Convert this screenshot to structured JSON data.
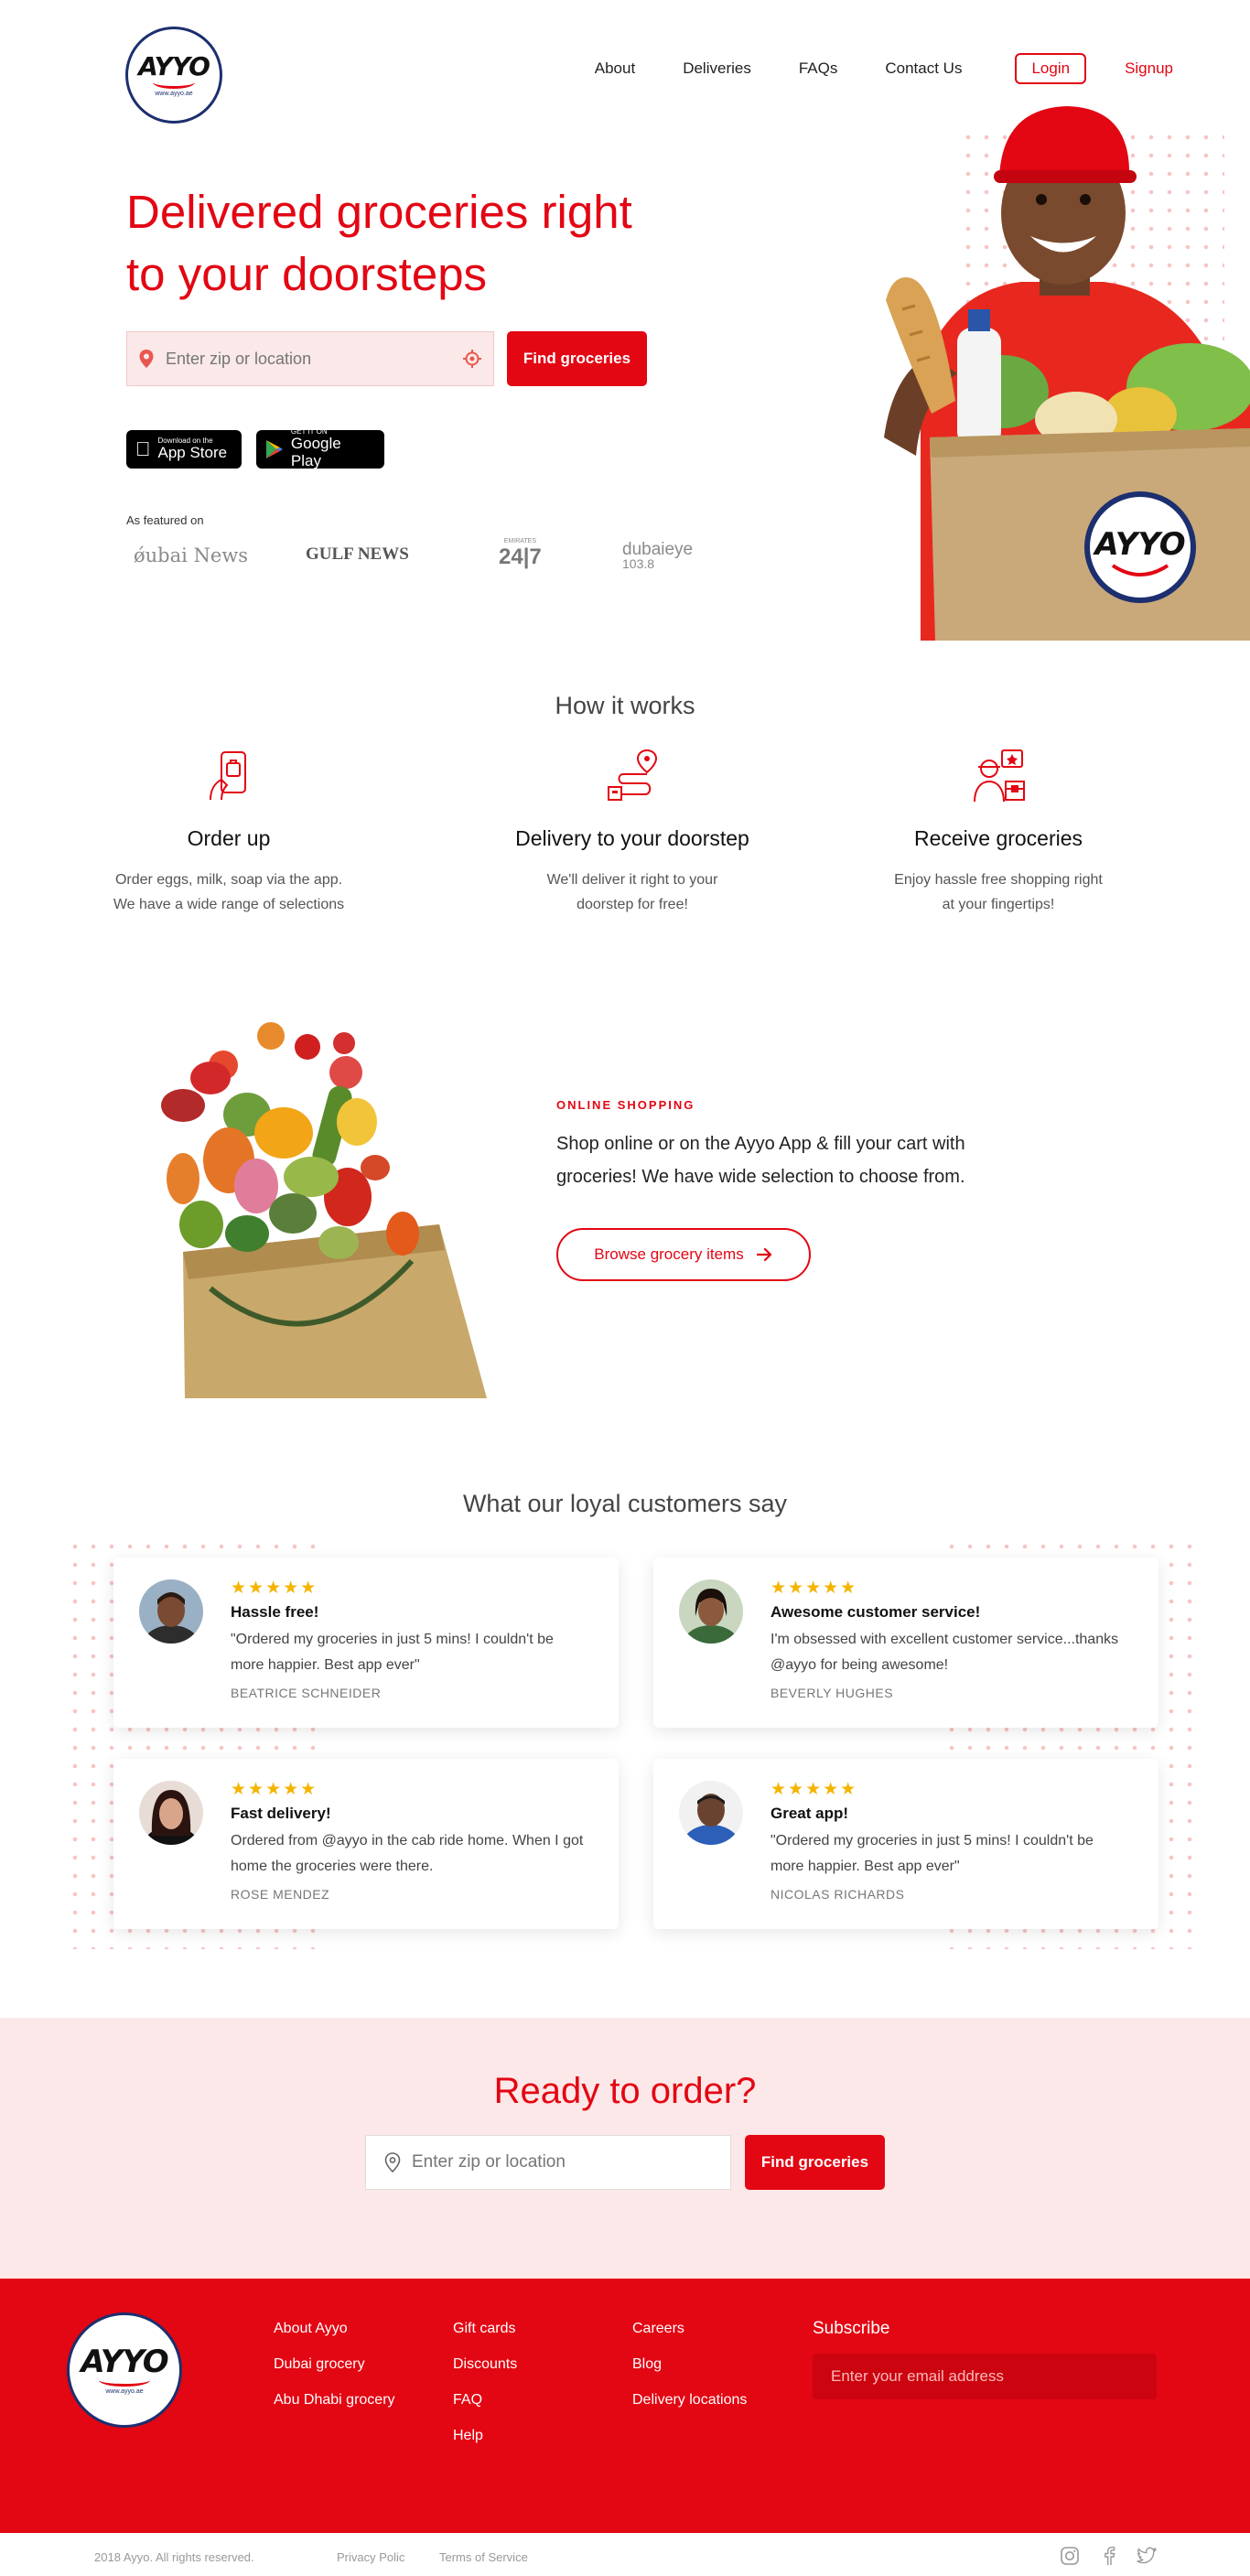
{
  "nav": {
    "logo_text": "AYYO",
    "logo_url": "www.ayyo.ae",
    "links": [
      "About",
      "Deliveries",
      "FAQs",
      "Contact Us"
    ],
    "login": "Login",
    "signup": "Signup"
  },
  "hero": {
    "title_line1": "Delivered groceries right",
    "title_line2": "to your doorsteps",
    "search_placeholder": "Enter zip or location",
    "find_button": "Find groceries",
    "app_store": {
      "small": "Download on the",
      "big": "App Store"
    },
    "google_play": {
      "small": "GET IT ON",
      "big": "Google Play"
    },
    "featured_label": "As featured on",
    "press": [
      {
        "name": "Dubai News",
        "script": "ǿubai News"
      },
      {
        "name": "GULF NEWS"
      },
      {
        "name": "24|7",
        "sub": "EMIRATES"
      },
      {
        "name": "dubaieye",
        "sub": "103.8"
      }
    ]
  },
  "how": {
    "title": "How it works",
    "steps": [
      {
        "title": "Order up",
        "desc1": "Order eggs, milk, soap via the app.",
        "desc2": "We have a wide range of selections",
        "icon": "phone-order-icon"
      },
      {
        "title": "Delivery to your doorstep",
        "desc1": "We'll deliver it right to your",
        "desc2": "doorstep for free!",
        "icon": "delivery-route-icon"
      },
      {
        "title": "Receive groceries",
        "desc1": "Enjoy hassle free shopping right",
        "desc2": "at your fingertips!",
        "icon": "courier-package-icon"
      }
    ]
  },
  "shop": {
    "eyebrow": "ONLINE SHOPPING",
    "text": "Shop online or on the Ayyo App & fill your cart with groceries! We have wide selection to choose from.",
    "button": "Browse grocery items"
  },
  "testimonials": {
    "title": "What our loyal customers say",
    "stars": "★★★★★",
    "items": [
      {
        "title": "Hassle free!",
        "quote": "\"Ordered my groceries in just 5 mins! I couldn't be more happier. Best app ever\"",
        "name": "BEATRICE SCHNEIDER",
        "skin": "#7a4a32",
        "shirt": "#2d2d2d",
        "hair": "#2a1a12"
      },
      {
        "title": "Awesome customer service!",
        "quote": "I'm obsessed with excellent customer service...thanks @ayyo for being awesome!",
        "name": "BEVERLY HUGHES",
        "skin": "#8b5a3c",
        "shirt": "#3a6a3a",
        "hair": "#1a0f0a"
      },
      {
        "title": "Fast delivery!",
        "quote": "Ordered  from @ayyo in the cab ride home. When I got home the groceries were there.",
        "name": "ROSE MENDEZ",
        "skin": "#d9a58a",
        "shirt": "#111111",
        "hair": "#2b1410"
      },
      {
        "title": "Great app!",
        "quote": "\"Ordered my groceries in just 5 mins! I couldn't be more happier. Best app ever\"",
        "name": "NICOLAS RICHARDS",
        "skin": "#6a4330",
        "shirt": "#2b5fb8",
        "hair": "#1a1a1a"
      }
    ]
  },
  "cta": {
    "title": "Ready to order?",
    "search_placeholder": "Enter zip or location",
    "find_button": "Find groceries"
  },
  "footer": {
    "col1": [
      "About Ayyo",
      "Dubai grocery",
      "Abu Dhabi grocery"
    ],
    "col2": [
      "Gift cards",
      "Discounts",
      "FAQ",
      "Help"
    ],
    "col3": [
      "Careers",
      "Blog",
      "Delivery locations"
    ],
    "subscribe_title": "Subscribe",
    "subscribe_placeholder": "Enter your email address",
    "copyright": "2018 Ayyo. All rights reserved.",
    "privacy": "Privacy Polic",
    "terms": "Terms of Service",
    "social": [
      "instagram-icon",
      "facebook-icon",
      "twitter-icon"
    ]
  },
  "colors": {
    "brand_red": "#e30613",
    "pink_bg": "#fce8e8",
    "star": "#f5b400"
  }
}
